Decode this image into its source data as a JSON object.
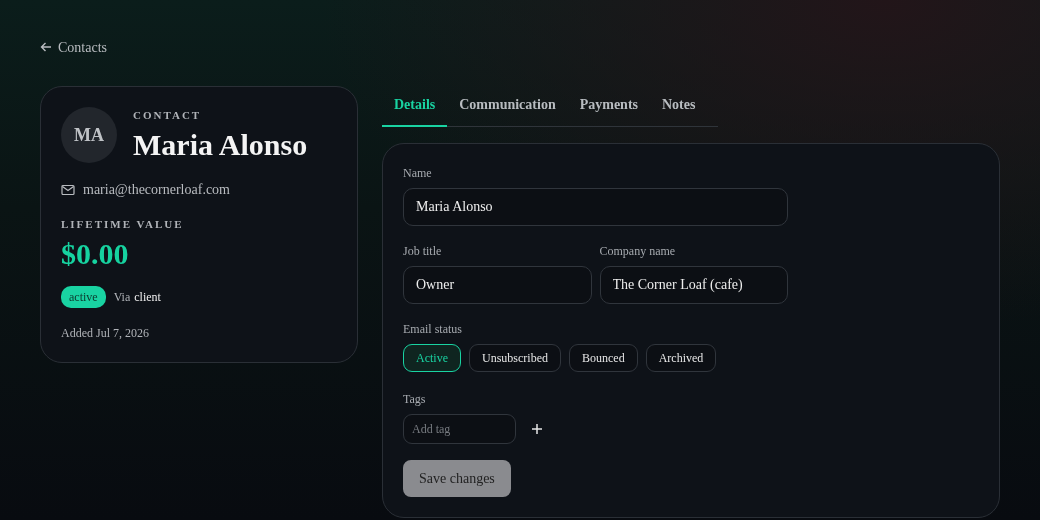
{
  "back_link": {
    "label": "Contacts"
  },
  "contact_card": {
    "avatar_initials": "MA",
    "eyebrow": "CONTACT",
    "name": "Maria Alonso",
    "email": "maria@thecornerloaf.com",
    "lifetime_value_label": "LIFETIME VALUE",
    "lifetime_value": "$0.00",
    "status_badge": "active",
    "via_label": "Via",
    "via_source": "client",
    "added": "Added Jul 7, 2026"
  },
  "tabs": [
    {
      "label": "Details",
      "selected": true
    },
    {
      "label": "Communication",
      "selected": false
    },
    {
      "label": "Payments",
      "selected": false
    },
    {
      "label": "Notes",
      "selected": false
    }
  ],
  "form": {
    "name_label": "Name",
    "name_value": "Maria Alonso",
    "job_title_label": "Job title",
    "job_title_value": "Owner",
    "company_label": "Company name",
    "company_value": "The Corner Loaf (cafe)",
    "email_status_label": "Email status",
    "email_statuses": [
      {
        "label": "Active",
        "selected": true
      },
      {
        "label": "Unsubscribed",
        "selected": false
      },
      {
        "label": "Bounced",
        "selected": false
      },
      {
        "label": "Archived",
        "selected": false
      }
    ],
    "tags_label": "Tags",
    "tag_placeholder": "Add tag",
    "save_button": {
      "label": "Save changes",
      "disabled": true
    }
  }
}
